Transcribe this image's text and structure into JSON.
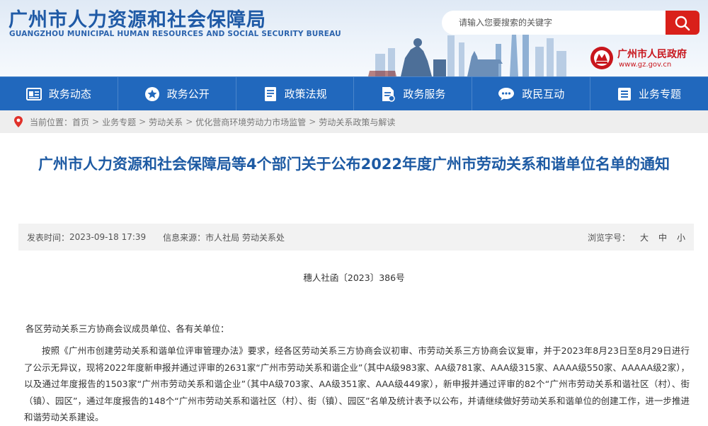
{
  "header": {
    "title": "广州市人力资源和社会保障局",
    "subtitle": "GUANGZHOU MUNICIPAL HUMAN RESOURCES AND SOCIAL SECURITY BUREAU",
    "search_placeholder": "请输入您要搜索的关键字",
    "search_icon": "search-icon",
    "gov_name": "广州市人民政府",
    "gov_url": "www.gz.gov.cn"
  },
  "nav": {
    "items": [
      {
        "label": "政务动态",
        "icon": "news-icon"
      },
      {
        "label": "政务公开",
        "icon": "star-icon"
      },
      {
        "label": "政策法规",
        "icon": "book-icon"
      },
      {
        "label": "政务服务",
        "icon": "document-icon"
      },
      {
        "label": "政民互动",
        "icon": "chat-icon"
      },
      {
        "label": "业务专题",
        "icon": "list-icon"
      }
    ]
  },
  "breadcrumb": {
    "prefix": "当前位置：",
    "items": [
      "首页",
      "业务专题",
      "劳动关系",
      "优化营商环境劳动力市场监管",
      "劳动关系政策与解读"
    ],
    "separator": ">"
  },
  "article": {
    "title": "广州市人力资源和社会保障局等4个部门关于公布2022年度广州市劳动关系和谐单位名单的通知",
    "publish_label": "发表时间：",
    "publish_time": "2023-09-18 17:39",
    "source_label": "信息来源：",
    "source": "市人社局 劳动关系处",
    "font_label": "浏览字号：",
    "font_sizes": [
      "大",
      "中",
      "小"
    ],
    "doc_number": "穗人社函〔2023〕386号",
    "salutation": "各区劳动关系三方协商会议成员单位、各有关单位：",
    "body": "按照《广州市创建劳动关系和谐单位评审管理办法》要求，经各区劳动关系三方协商会议初审、市劳动关系三方协商会议复审，并于2023年8月23日至8月29日进行了公示无异议，现将2022年度新申报并通过评审的2631家“广州市劳动关系和谐企业”（其中A级983家、AA级781家、AAA级315家、AAAA级550家、AAAAA级2家），以及通过年度报告的1503家“广州市劳动关系和谐企业”（其中A级703家、AA级351家、AAA级449家），新申报并通过评审的82个“广州市劳动关系和谐社区（村）、街（镇）、园区”，通过年度报告的148个“广州市劳动关系和谐社区（村）、街（镇）、园区”名单及统计表予以公布，并请继续做好劳动关系和谐单位的创建工作，进一步推进和谐劳动关系建设。"
  },
  "colors": {
    "nav_bg": "#2168bd",
    "title_blue": "#1d5aa3",
    "search_red": "#d9201a",
    "gov_red": "#c8161d"
  }
}
